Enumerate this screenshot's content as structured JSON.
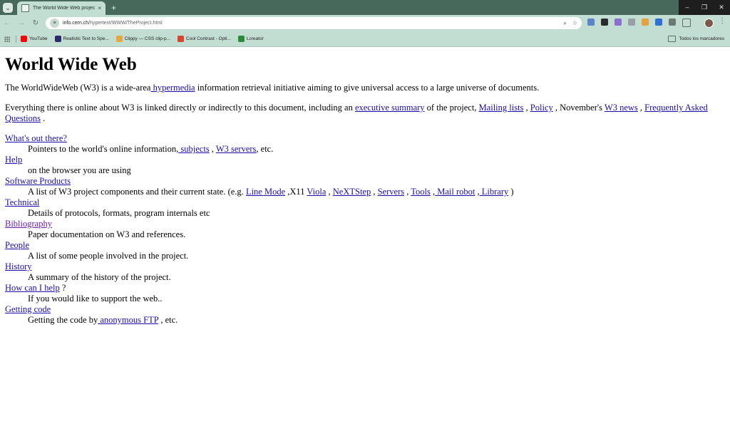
{
  "browser": {
    "tab_title": "The World Wide Web project",
    "tab_close": "×",
    "new_tab": "+",
    "window_controls": {
      "minimize": "–",
      "restore": "❐",
      "close": "✕"
    },
    "url_host": "info.cern.ch",
    "url_path": "/hypertext/WWW/TheProject.html",
    "bookmarks": [
      {
        "label": "YouTube",
        "icon": "youtube-icon",
        "color": "#ff0000"
      },
      {
        "label": "Realistic Text to Spe...",
        "icon": "speech-icon",
        "color": "#2b2b6b"
      },
      {
        "label": "Clippy — CSS clip-p...",
        "icon": "clippy-icon",
        "color": "#e6a73c"
      },
      {
        "label": "Cool Contrast - Opti...",
        "icon": "contrast-icon",
        "color": "#d8442d"
      },
      {
        "label": "Lcreator",
        "icon": "lcreator-icon",
        "color": "#2a8a3a"
      }
    ],
    "all_bookmarks": "Todos los marcadores"
  },
  "page": {
    "title": "World Wide Web",
    "intro": {
      "before": "The WorldWideWeb (W3) is a wide-area",
      "link": " hypermedia",
      "after": " information retrieval initiative aiming to give universal access to a large universe of documents."
    },
    "summary": {
      "t1": "Everything there is online about W3 is linked directly or indirectly to this document, including an ",
      "l1": "executive summary",
      "t2": " of the project, ",
      "l2": "Mailing lists",
      "t3": " , ",
      "l3": "Policy",
      "t4": " , November's ",
      "l4": "W3 news",
      "t5": " , ",
      "l5": "Frequently Asked Questions",
      "t6": " ."
    },
    "items": {
      "whats_out": {
        "term": "What's out there?",
        "d1": "Pointers to the world's online information,",
        "l1": " subjects",
        "d2": " , ",
        "l2": "W3 servers",
        "d3": ", etc."
      },
      "help": {
        "term": "Help",
        "desc": "on the browser you are using"
      },
      "software": {
        "term": "Software Products",
        "d1": "A list of W3 project components and their current state. (e.g. ",
        "l1": "Line Mode",
        "d2": " ,X11 ",
        "l2": "Viola",
        "d3": " , ",
        "l3": "NeXTStep",
        "d4": " , ",
        "l4": "Servers",
        "d5": " , ",
        "l5": "Tools",
        "d6": " ,",
        "l6": " Mail robot",
        "d7": " ,",
        "l7": " Library",
        "d8": " )"
      },
      "technical": {
        "term": "Technical",
        "desc": "Details of protocols, formats, program internals etc"
      },
      "bibliography": {
        "term": "Bibliography",
        "desc": "Paper documentation on W3 and references."
      },
      "people": {
        "term": "People",
        "desc": "A list of some people involved in the project."
      },
      "history": {
        "term": "History",
        "desc": "A summary of the history of the project."
      },
      "how_help": {
        "term": "How can I help",
        "suffix": " ?",
        "desc": "If you would like to support the web.."
      },
      "getting_code": {
        "term": "Getting code",
        "d1": "Getting the code by",
        "l1": " anonymous FTP",
        "d2": " , etc."
      }
    }
  }
}
